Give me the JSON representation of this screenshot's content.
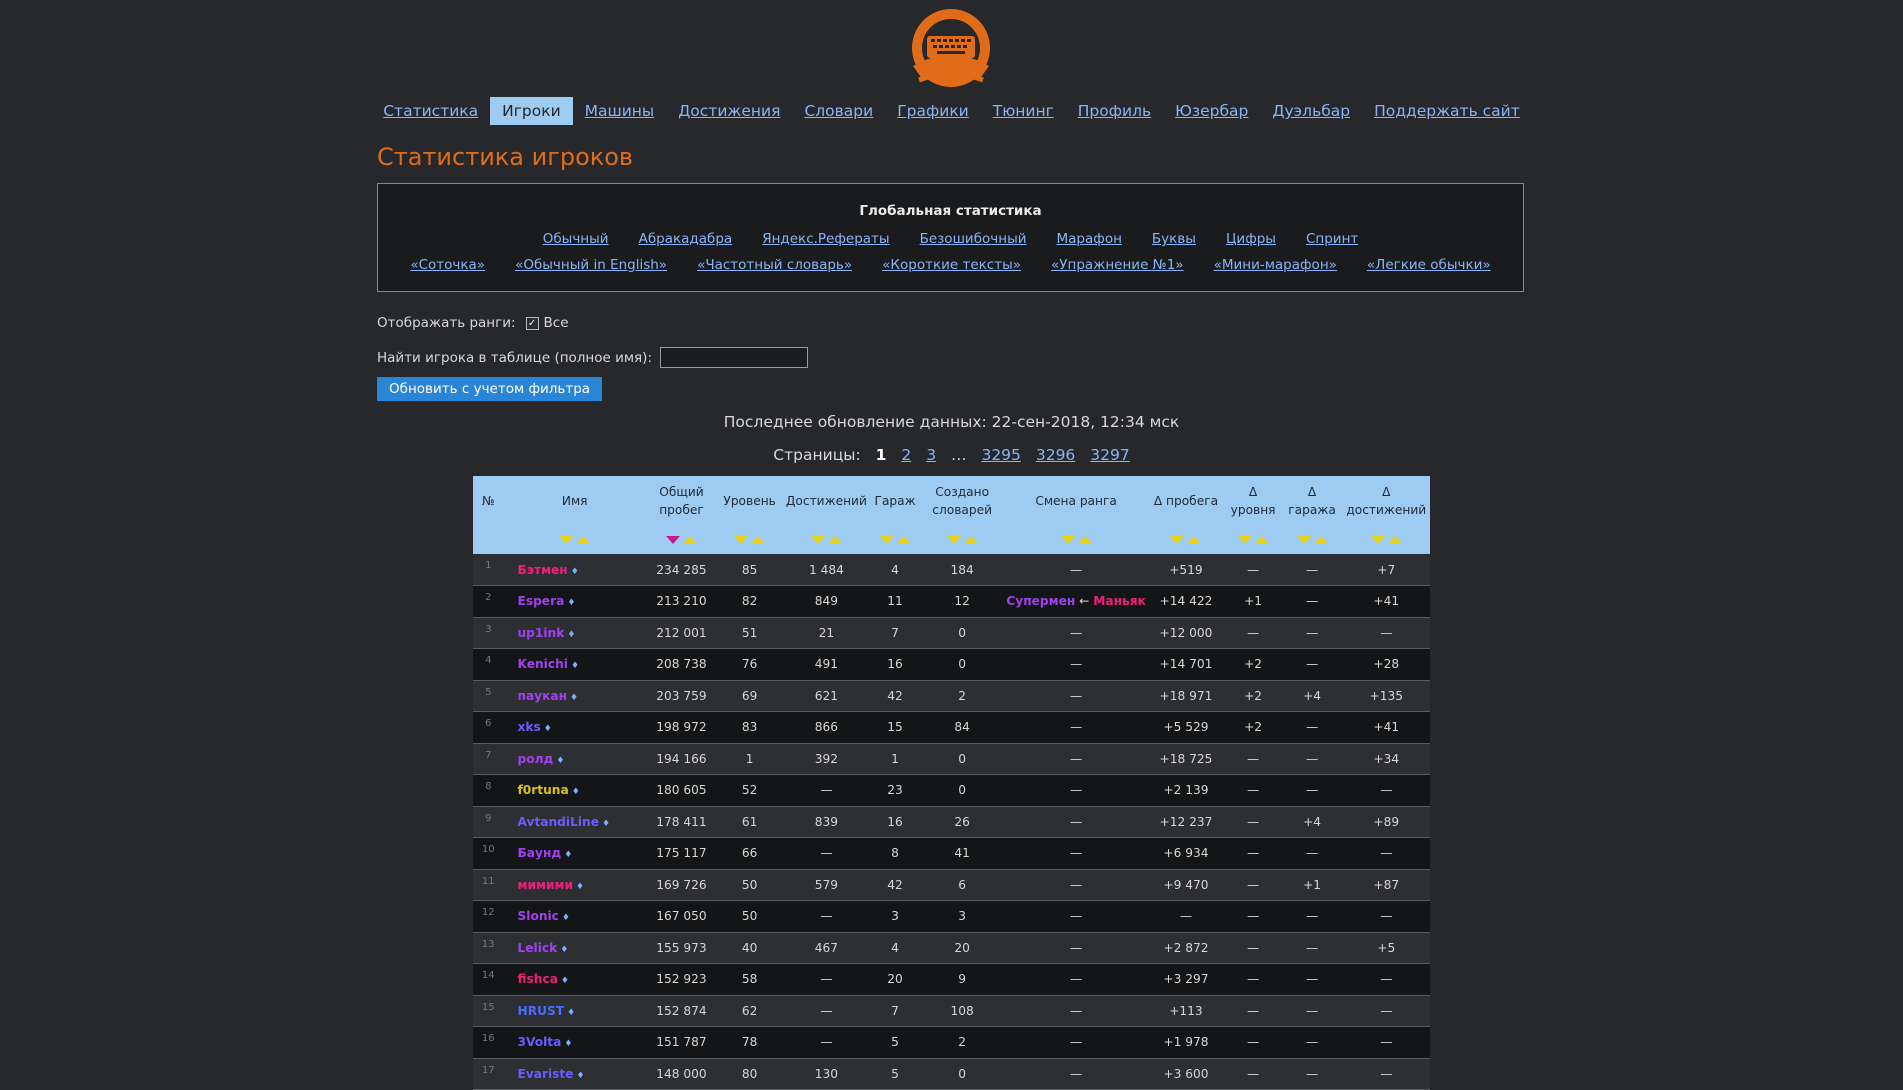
{
  "nav": {
    "items": [
      "Статистика",
      "Игроки",
      "Машины",
      "Достижения",
      "Словари",
      "Графики",
      "Тюнинг",
      "Профиль",
      "Юзербар",
      "Дуэльбар",
      "Поддержать сайт"
    ],
    "active": "Игроки"
  },
  "page_title": "Статистика игроков",
  "global": {
    "title": "Глобальная статистика",
    "modes_row1": [
      "Обычный",
      "Абракадабра",
      "Яндекс.Рефераты",
      "Безошибочный",
      "Марафон",
      "Буквы",
      "Цифры",
      "Спринт"
    ],
    "modes_row2": [
      "«Соточка»",
      "«Обычный in English»",
      "«Частотный словарь»",
      "«Короткие тексты»",
      "«Упражнение №1»",
      "«Мини-марафон»",
      "«Легкие обычки»"
    ]
  },
  "filters": {
    "show_ranks_label": "Отображать ранги:",
    "all_label": "Все",
    "all_checked": true,
    "find_label": "Найти игрока в таблице (полное имя):",
    "find_value": "",
    "update_button": "Обновить с учетом фильтра"
  },
  "last_update": "Последнее обновление данных: 22-сен-2018, 12:34 мск",
  "pagination": {
    "label": "Страницы:",
    "current": "1",
    "pages": [
      "2",
      "3"
    ],
    "ellipsis": "…",
    "last_pages": [
      "3295",
      "3296",
      "3297"
    ]
  },
  "table": {
    "headers": [
      {
        "text": "№",
        "sort": false
      },
      {
        "text": "Имя",
        "sort": true
      },
      {
        "text": "Общий пробег",
        "sort": true,
        "active": true
      },
      {
        "text": "Уровень",
        "sort": true
      },
      {
        "text": "Достижений",
        "sort": true
      },
      {
        "text": "Гараж",
        "sort": true
      },
      {
        "text": "Создано словарей",
        "sort": true
      },
      {
        "text": "Смена ранга",
        "sort": true
      },
      {
        "text": "Δ пробега",
        "sort": true
      },
      {
        "text": "Δ уровня",
        "sort": true
      },
      {
        "text": "Δ гаража",
        "sort": true
      },
      {
        "text": "Δ достижений",
        "sort": true
      }
    ],
    "rows": [
      {
        "n": "1",
        "name": "Бэтмен",
        "color": "#f0207a",
        "mileage": "234 285",
        "level": "85",
        "ach": "1 484",
        "garage": "4",
        "dicts": "184",
        "rank": "—",
        "d_mileage": "+519",
        "d_level": "—",
        "d_garage": "—",
        "d_ach": "+7"
      },
      {
        "n": "2",
        "name": "Espera",
        "color": "#a040f0",
        "mileage": "213 210",
        "level": "82",
        "ach": "849",
        "garage": "11",
        "dicts": "12",
        "rank_change": {
          "from": "Супермен",
          "arrow": "←",
          "to": "Маньяк"
        },
        "d_mileage": "+14 422",
        "d_level": "+1",
        "d_garage": "—",
        "d_ach": "+41"
      },
      {
        "n": "3",
        "name": "up1ink",
        "color": "#a040f0",
        "mileage": "212 001",
        "level": "51",
        "ach": "21",
        "garage": "7",
        "dicts": "0",
        "rank": "—",
        "d_mileage": "+12 000",
        "d_level": "—",
        "d_garage": "—",
        "d_ach": "—"
      },
      {
        "n": "4",
        "name": "Kenichi",
        "color": "#a040f0",
        "mileage": "208 738",
        "level": "76",
        "ach": "491",
        "garage": "16",
        "dicts": "0",
        "rank": "—",
        "d_mileage": "+14 701",
        "d_level": "+2",
        "d_garage": "—",
        "d_ach": "+28"
      },
      {
        "n": "5",
        "name": "паукан",
        "color": "#a040f0",
        "mileage": "203 759",
        "level": "69",
        "ach": "621",
        "garage": "42",
        "dicts": "2",
        "rank": "—",
        "d_mileage": "+18 971",
        "d_level": "+2",
        "d_garage": "+4",
        "d_ach": "+135"
      },
      {
        "n": "6",
        "name": "xks",
        "color": "#6a5cff",
        "mileage": "198 972",
        "level": "83",
        "ach": "866",
        "garage": "15",
        "dicts": "84",
        "rank": "—",
        "d_mileage": "+5 529",
        "d_level": "+2",
        "d_garage": "—",
        "d_ach": "+41"
      },
      {
        "n": "7",
        "name": "ролд",
        "color": "#a040f0",
        "mileage": "194 166",
        "level": "1",
        "ach": "392",
        "garage": "1",
        "dicts": "0",
        "rank": "—",
        "d_mileage": "+18 725",
        "d_level": "—",
        "d_garage": "—",
        "d_ach": "+34"
      },
      {
        "n": "8",
        "name": "f0rtuna",
        "color": "#d8c21a",
        "mileage": "180 605",
        "level": "52",
        "ach": "—",
        "garage": "23",
        "dicts": "0",
        "rank": "—",
        "d_mileage": "+2 139",
        "d_level": "—",
        "d_garage": "—",
        "d_ach": "—"
      },
      {
        "n": "9",
        "name": "AvtandiLine",
        "color": "#6a5cff",
        "mileage": "178 411",
        "level": "61",
        "ach": "839",
        "garage": "16",
        "dicts": "26",
        "rank": "—",
        "d_mileage": "+12 237",
        "d_level": "—",
        "d_garage": "+4",
        "d_ach": "+89"
      },
      {
        "n": "10",
        "name": "Баунд",
        "color": "#a040f0",
        "mileage": "175 117",
        "level": "66",
        "ach": "—",
        "garage": "8",
        "dicts": "41",
        "rank": "—",
        "d_mileage": "+6 934",
        "d_level": "—",
        "d_garage": "—",
        "d_ach": "—"
      },
      {
        "n": "11",
        "name": "мимими",
        "color": "#f0207a",
        "mileage": "169 726",
        "level": "50",
        "ach": "579",
        "garage": "42",
        "dicts": "6",
        "rank": "—",
        "d_mileage": "+9 470",
        "d_level": "—",
        "d_garage": "+1",
        "d_ach": "+87"
      },
      {
        "n": "12",
        "name": "Slonic",
        "color": "#a040f0",
        "mileage": "167 050",
        "level": "50",
        "ach": "—",
        "garage": "3",
        "dicts": "3",
        "rank": "—",
        "d_mileage": "—",
        "d_level": "—",
        "d_garage": "—",
        "d_ach": "—"
      },
      {
        "n": "13",
        "name": "Lelick",
        "color": "#a040f0",
        "mileage": "155 973",
        "level": "40",
        "ach": "467",
        "garage": "4",
        "dicts": "20",
        "rank": "—",
        "d_mileage": "+2 872",
        "d_level": "—",
        "d_garage": "—",
        "d_ach": "+5"
      },
      {
        "n": "14",
        "name": "fishca",
        "color": "#f0207a",
        "mileage": "152 923",
        "level": "58",
        "ach": "—",
        "garage": "20",
        "dicts": "9",
        "rank": "—",
        "d_mileage": "+3 297",
        "d_level": "—",
        "d_garage": "—",
        "d_ach": "—"
      },
      {
        "n": "15",
        "name": "HRUST",
        "color": "#4a6cff",
        "mileage": "152 874",
        "level": "62",
        "ach": "—",
        "garage": "7",
        "dicts": "108",
        "rank": "—",
        "d_mileage": "+113",
        "d_level": "—",
        "d_garage": "—",
        "d_ach": "—"
      },
      {
        "n": "16",
        "name": "3Volta",
        "color": "#6a5cff",
        "mileage": "151 787",
        "level": "78",
        "ach": "—",
        "garage": "5",
        "dicts": "2",
        "rank": "—",
        "d_mileage": "+1 978",
        "d_level": "—",
        "d_garage": "—",
        "d_ach": "—"
      },
      {
        "n": "17",
        "name": "Evariste",
        "color": "#6a5cff",
        "mileage": "148 000",
        "level": "80",
        "ach": "130",
        "garage": "5",
        "dicts": "0",
        "rank": "—",
        "d_mileage": "+3 600",
        "d_level": "—",
        "d_garage": "—",
        "d_ach": "—"
      }
    ]
  },
  "colors": {
    "accent": "#e06c1a",
    "link": "#8ab4f8",
    "header_bg": "#9ecbf2",
    "button_bg": "#2a85d6"
  },
  "logo_icon": "steering-wheel-keyboard-logo"
}
